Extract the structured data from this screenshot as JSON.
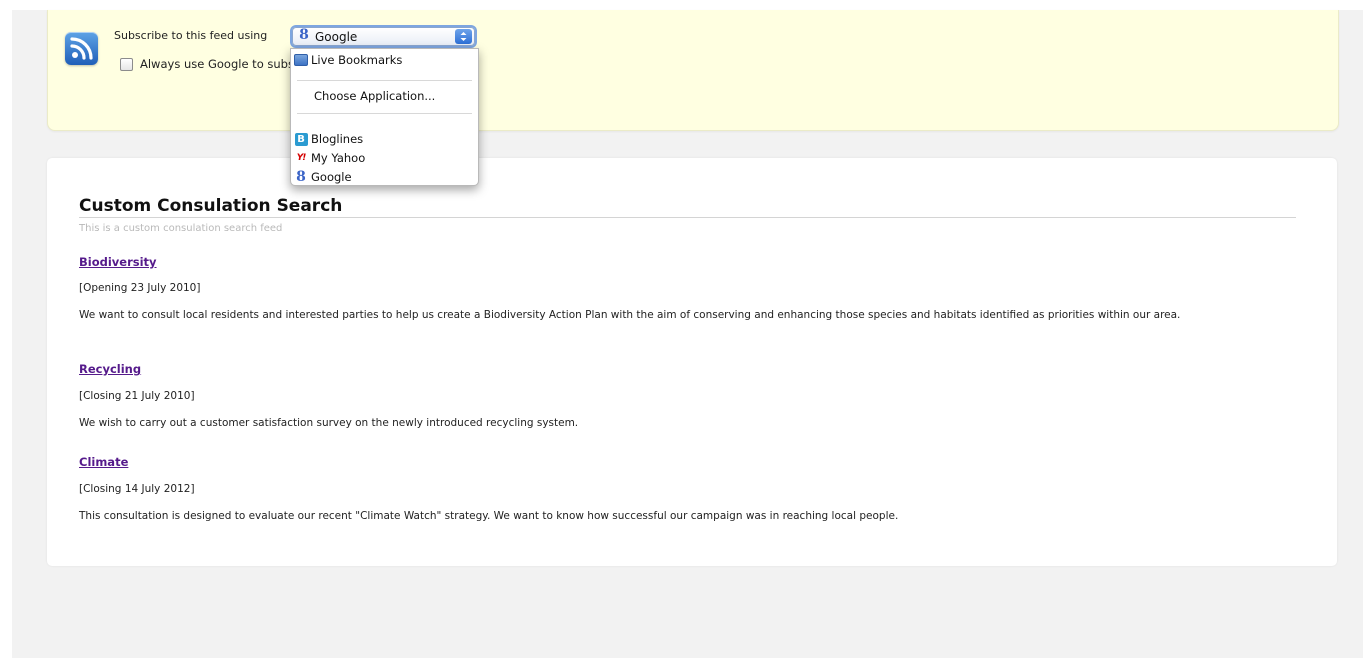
{
  "subscribe": {
    "label": "Subscribe to this feed using",
    "always_label": "Always use Google to subscribe to feeds.",
    "selected": "Google",
    "icon": "rss-icon"
  },
  "menu": {
    "items": [
      {
        "label": "Live Bookmarks",
        "icon": "live-bookmarks-icon"
      },
      {
        "label": "Choose Application...",
        "icon": ""
      },
      {
        "label": "Bloglines",
        "icon": "bloglines-icon"
      },
      {
        "label": "My Yahoo",
        "icon": "yahoo-icon"
      },
      {
        "label": "Google",
        "icon": "google-icon"
      }
    ]
  },
  "feed": {
    "title": "Custom Consulation Search",
    "subtitle": "This is a custom consulation search feed",
    "entries": [
      {
        "title": "Biodiversity",
        "date": "[Opening 23 July 2010]",
        "body": "We want to consult local residents and interested parties to help us create a Biodiversity Action Plan with the aim of conserving and enhancing those species and habitats identified as priorities within our area."
      },
      {
        "title": "Recycling",
        "date": "[Closing 21 July 2010]",
        "body": "We wish to carry out a customer satisfaction survey on the newly introduced recycling system."
      },
      {
        "title": "Climate",
        "date": "[Closing 14 July 2012]",
        "body": "This consultation is designed to evaluate our recent \"Climate Watch\" strategy. We want to know how successful our campaign was in reaching local people."
      }
    ]
  },
  "colors": {
    "subscribe_bg": "#ffffe1",
    "link": "#551a8b",
    "page_bg": "#f2f2f2"
  }
}
